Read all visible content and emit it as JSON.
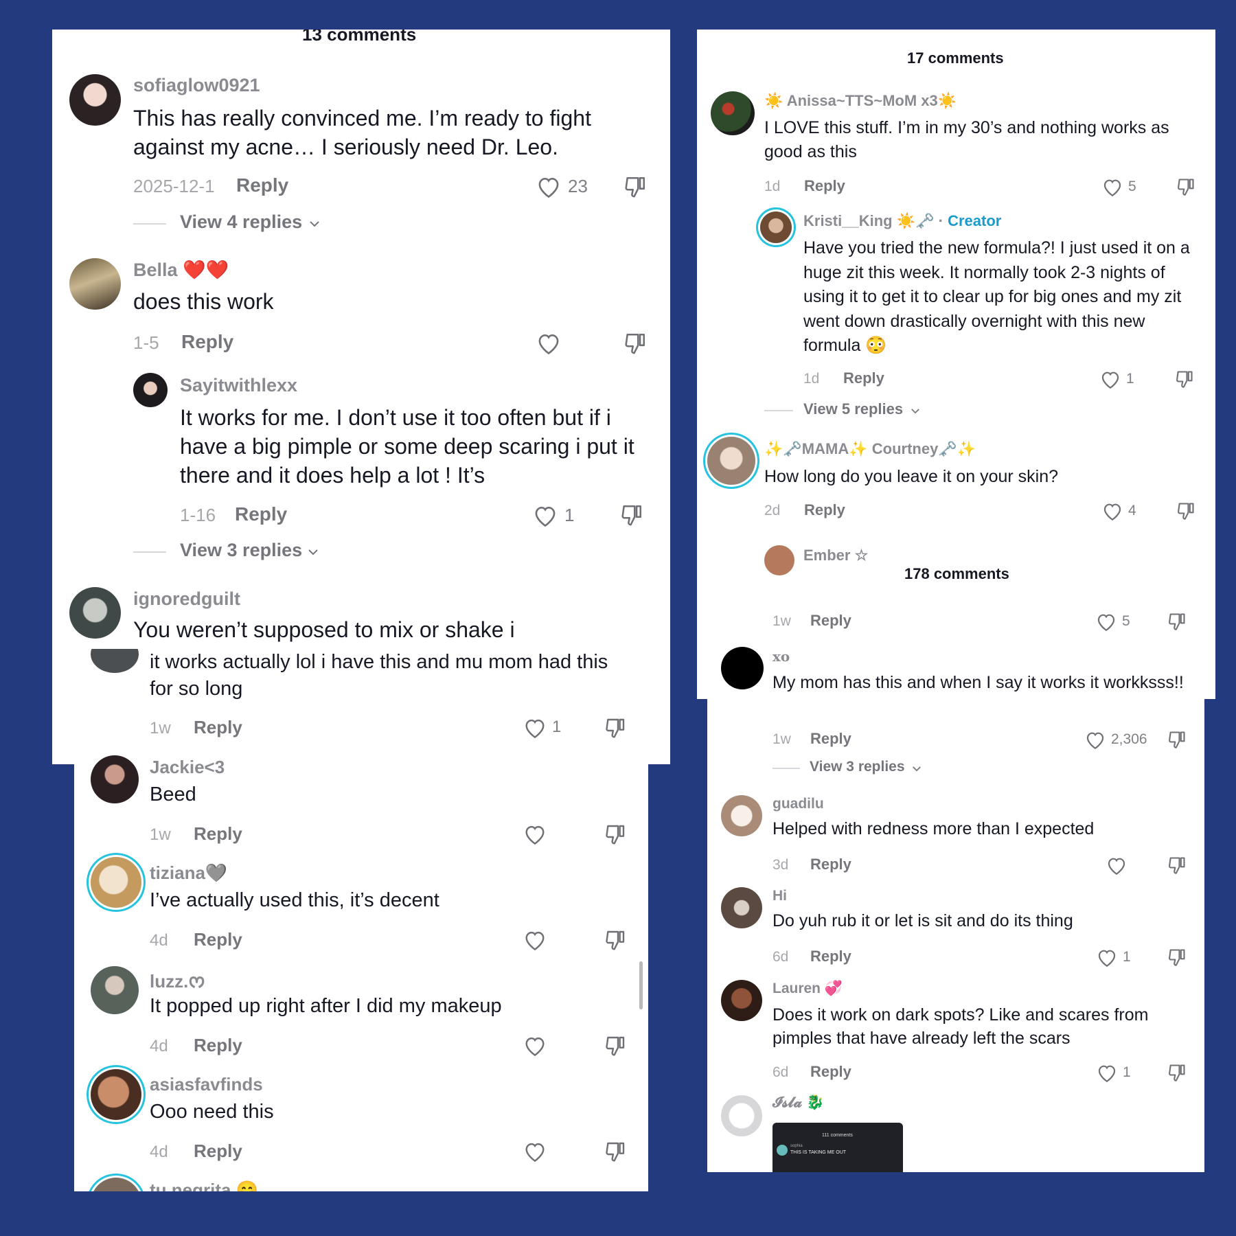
{
  "panel1": {
    "count_label": "13 comments",
    "comments": [
      {
        "user": "sofiaglow0921",
        "text": "This has really convinced me. I’m ready to fight against my acne… I seriously need Dr. Leo.",
        "date": "2025-12-1",
        "reply": "Reply",
        "likes": "23",
        "view": "View 4 replies"
      },
      {
        "user": "Bella",
        "emoji": "❤️❤️",
        "text": "does this work",
        "date": "1-5",
        "reply": "Reply",
        "likes": ""
      },
      {
        "user": "Sayitwithlexx",
        "text": "It works for me. I don’t use it too often but if i have a big pimple or some deep scaring i put it there and it does help a lot ! It’s",
        "date": "1-16",
        "reply": "Reply",
        "likes": "1",
        "view": "View 3 replies"
      },
      {
        "user": "ignoredguilt",
        "text": "You weren’t supposed to mix or shake i"
      }
    ]
  },
  "panel2": {
    "comments": [
      {
        "text": "it works actually lol i have this and mu mom had this for so long",
        "date": "1w",
        "reply": "Reply",
        "likes": "1"
      },
      {
        "user": "Jackie<3",
        "text": "Beed",
        "date": "1w",
        "reply": "Reply"
      },
      {
        "user": "tiziana",
        "emoji": "🩶",
        "text": "I’ve actually used this, it’s decent",
        "date": "4d",
        "reply": "Reply"
      },
      {
        "user": "luzz.",
        "emoji": "ᰔ",
        "text": "It popped up right after I did my makeup",
        "date": "4d",
        "reply": "Reply"
      },
      {
        "user": "asiasfavfinds",
        "text": "Ooo need this",
        "date": "4d",
        "reply": "Reply"
      },
      {
        "user": "tu negrita",
        "emoji": "😄"
      }
    ]
  },
  "panel3": {
    "count_label": "17 comments",
    "comments": [
      {
        "user": "Anissa~TTS~MoM x3",
        "text": "I LOVE this stuff. I’m in my 30’s and nothing works as good as this",
        "date": "1d",
        "reply": "Reply",
        "likes": "5"
      },
      {
        "user": "Kristi__King",
        "creator": "Creator",
        "text": "Have you tried the new formula?! I just used it on a huge zit this week. It normally took 2-3 nights of using it to get it to clear up for big ones and my zit went down drastically overnight with this new formula",
        "date": "1d",
        "reply": "Reply",
        "likes": "1",
        "view": "View 5 replies"
      },
      {
        "user": "MAMA",
        "user2": "Courtney",
        "text": "How long do you leave it on your skin?",
        "date": "2d",
        "reply": "Reply",
        "likes": "4"
      },
      {
        "user": "Ember ☆"
      }
    ],
    "second_count_label": "178 comments",
    "top_meta": {
      "date": "1w",
      "reply": "Reply",
      "likes": "5"
    }
  },
  "panel4": {
    "comments": [
      {
        "user": "xo",
        "text": "My mom has this and when I say it works it workksss!!",
        "date": "1w",
        "reply": "Reply",
        "likes": "2,306",
        "view": "View 3 replies"
      },
      {
        "user": "guadilu",
        "text": "Helped with redness more than I expected",
        "date": "3d",
        "reply": "Reply"
      },
      {
        "user": "Hi",
        "text": "Do yuh rub it or let is sit and do its thing",
        "date": "6d",
        "reply": "Reply",
        "likes": "1"
      },
      {
        "user": "Lauren",
        "emoji": "💞",
        "text": "Does it work on dark spots? Like and scares from pimples that have already left the scars",
        "date": "6d",
        "reply": "Reply",
        "likes": "1"
      },
      {
        "user": "𝓘𝓼𝓵𝓪",
        "emoji": "🐉"
      }
    ],
    "thumb": {
      "count_label": "111 comments",
      "user": "sophia",
      "text": "THIS IS TAKING ME OUT"
    }
  },
  "colors": {
    "background": "#233a7e",
    "ring": "#26c3df",
    "creator": "#1a9bc9"
  }
}
